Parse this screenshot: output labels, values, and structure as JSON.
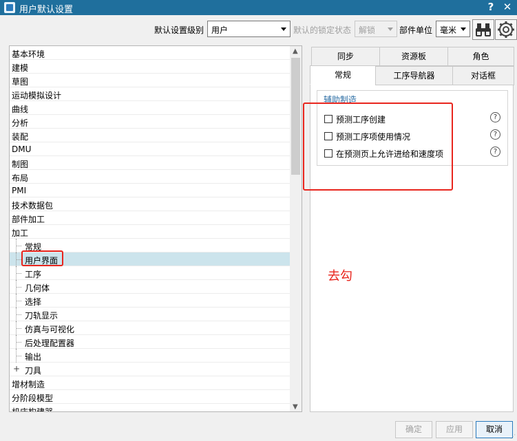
{
  "window": {
    "title": "用户默认设置",
    "help": "?",
    "close": "✕"
  },
  "toolbar": {
    "level_label": "默认设置级别",
    "level_value": "用户",
    "lock_label": "默认的锁定状态",
    "lock_value": "解锁",
    "unit_label": "部件单位",
    "unit_value": "毫米"
  },
  "tree": {
    "items": [
      {
        "label": "基本环境"
      },
      {
        "label": "建模"
      },
      {
        "label": "草图"
      },
      {
        "label": "运动模拟设计"
      },
      {
        "label": "曲线"
      },
      {
        "label": "分析"
      },
      {
        "label": "装配"
      },
      {
        "label": "DMU"
      },
      {
        "label": "制图"
      },
      {
        "label": "布局"
      },
      {
        "label": "PMI"
      },
      {
        "label": "技术数据包"
      },
      {
        "label": "部件加工"
      },
      {
        "label": "加工"
      },
      {
        "label": "常规"
      },
      {
        "label": "用户界面"
      },
      {
        "label": "工序"
      },
      {
        "label": "几何体"
      },
      {
        "label": "选择"
      },
      {
        "label": "刀轨显示"
      },
      {
        "label": "仿真与可视化"
      },
      {
        "label": "后处理配置器"
      },
      {
        "label": "输出"
      },
      {
        "label": "刀具"
      },
      {
        "label": "增材制造"
      },
      {
        "label": "分阶段模型"
      },
      {
        "label": "机床构建器"
      }
    ],
    "expand_symbol": "+"
  },
  "tabs": {
    "row1": [
      "同步",
      "资源板",
      "角色"
    ],
    "row2": [
      "常规",
      "工序导航器",
      "对话框"
    ]
  },
  "group": {
    "title": "辅助制造",
    "options": [
      {
        "label": "预测工序创建",
        "checked": false
      },
      {
        "label": "预测工序项使用情况",
        "checked": false
      },
      {
        "label": "在预测页上允许进给和速度项",
        "checked": false
      }
    ],
    "help_glyph": "?"
  },
  "annotation": "去勾",
  "buttons": {
    "ok": "确定",
    "apply": "应用",
    "cancel": "取消"
  },
  "colors": {
    "titlebar": "#1f6f9d",
    "annotation_red": "#e8251d",
    "selected_row": "#cce4ec",
    "group_title": "#2e6fa5"
  }
}
